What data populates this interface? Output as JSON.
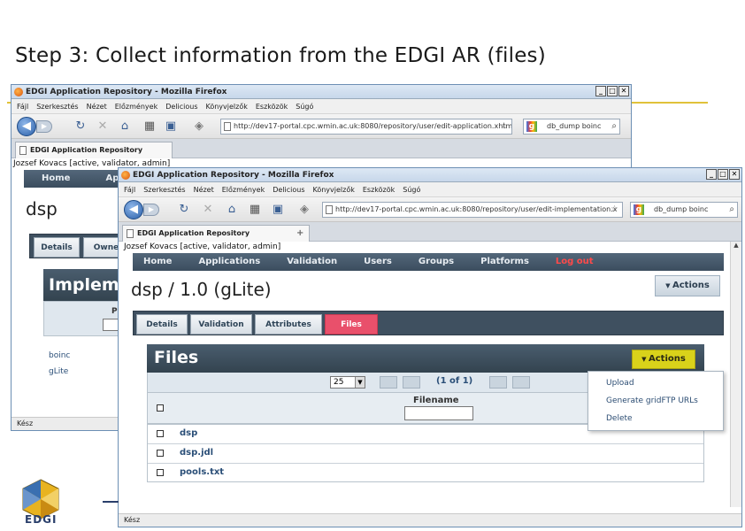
{
  "slide": {
    "title": "Step 3: Collect information from the EDGI AR (files)",
    "logo_text": "EDGI"
  },
  "window_back": {
    "title": "EDGI Application Repository - Mozilla Firefox",
    "menu": [
      "Fájl",
      "Szerkesztés",
      "Nézet",
      "Előzmények",
      "Delicious",
      "Könyvjelzők",
      "Eszközök",
      "Súgó"
    ],
    "url": "http://dev17-portal.cpc.wmin.ac.uk:8080/repository/user/edit-application.xhtml",
    "search": "db_dump boinc",
    "tab": "EDGI Application Repository",
    "user": "Jozsef Kovacs [active, validator, admin]",
    "nav": [
      "Home",
      "Appl"
    ],
    "heading": "dsp",
    "subtabs": [
      "Details",
      "Owne"
    ],
    "panel_title": "Impleme",
    "list": [
      "boinc",
      "gLite"
    ],
    "status": "Kész",
    "col_header_letter": "P"
  },
  "window_front": {
    "title": "EDGI Application Repository - Mozilla Firefox",
    "menu": [
      "Fájl",
      "Szerkesztés",
      "Nézet",
      "Előzmények",
      "Delicious",
      "Könyvjelzők",
      "Eszközök",
      "Súgó"
    ],
    "url": "http://dev17-portal.cpc.wmin.ac.uk:8080/repository/user/edit-implementation.x",
    "search": "db_dump boinc",
    "tab": "EDGI Application Repository",
    "user": "Jozsef Kovacs [active, validator, admin]",
    "nav": [
      "Home",
      "Applications",
      "Validation",
      "Users",
      "Groups",
      "Platforms",
      "Log out"
    ],
    "heading": "dsp / 1.0 (gLite)",
    "actions_label": "Actions",
    "subtabs": [
      "Details",
      "Validation",
      "Attributes",
      "Files"
    ],
    "active_subtab": "Files",
    "files_panel": {
      "title": "Files",
      "actions_label": "Actions",
      "page_size": "25",
      "pager": "(1 of 1)",
      "column_header": "Filename",
      "files": [
        "dsp",
        "dsp.jdl",
        "pools.txt"
      ]
    },
    "actions_menu": [
      "Upload",
      "Generate gridFTP URLs",
      "Delete"
    ],
    "status": "Kész"
  },
  "colors": {
    "gold_line": "#e0c23a",
    "nav_bg": "#3b4d5e",
    "active_tab": "#e9506b",
    "actions_yellow": "#d9d21a",
    "logout": "#ff4a4a"
  }
}
